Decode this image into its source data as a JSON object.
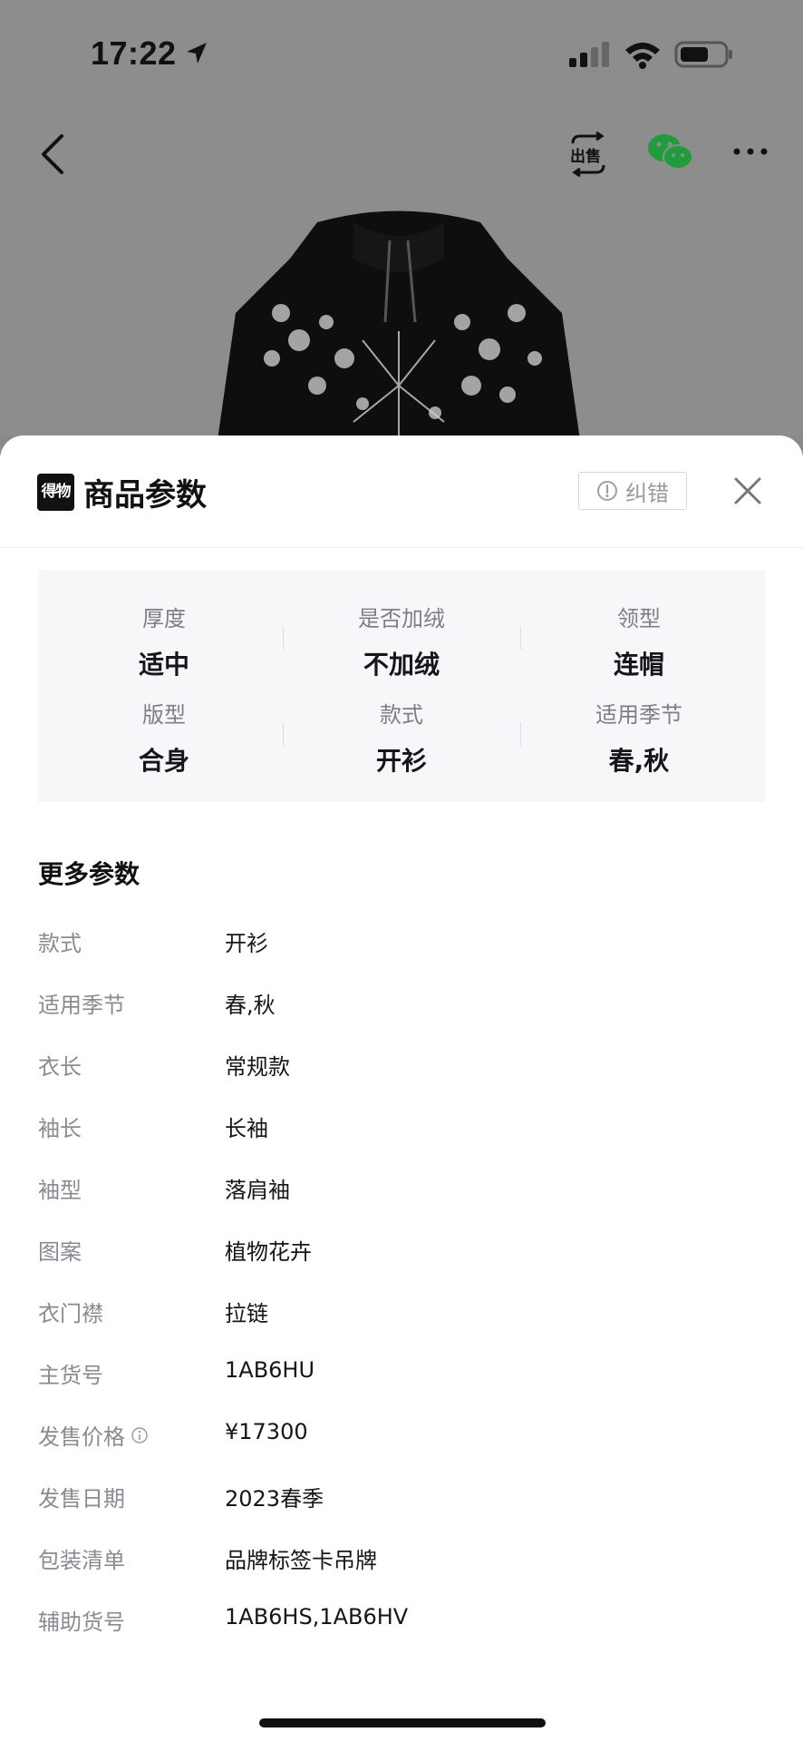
{
  "status_bar": {
    "time": "17:22"
  },
  "sheet": {
    "logo_text": "得物",
    "title": "商品参数",
    "report_label": "纠错"
  },
  "params": [
    {
      "label": "厚度",
      "value": "适中"
    },
    {
      "label": "是否加绒",
      "value": "不加绒"
    },
    {
      "label": "领型",
      "value": "连帽"
    },
    {
      "label": "版型",
      "value": "合身"
    },
    {
      "label": "款式",
      "value": "开衫"
    },
    {
      "label": "适用季节",
      "value": "春,秋"
    }
  ],
  "more": {
    "title": "更多参数",
    "rows": [
      {
        "key": "款式",
        "value": "开衫"
      },
      {
        "key": "适用季节",
        "value": "春,秋"
      },
      {
        "key": "衣长",
        "value": "常规款"
      },
      {
        "key": "袖长",
        "value": "长袖"
      },
      {
        "key": "袖型",
        "value": "落肩袖"
      },
      {
        "key": "图案",
        "value": "植物花卉"
      },
      {
        "key": "衣门襟",
        "value": "拉链"
      },
      {
        "key": "主货号",
        "value": "1AB6HU"
      },
      {
        "key": "发售价格",
        "value": "¥17300"
      },
      {
        "key": "发售日期",
        "value": "2023春季"
      },
      {
        "key": "包装清单",
        "value": "品牌标签卡吊牌"
      },
      {
        "key": "辅助货号",
        "value": "1AB6HS,1AB6HV"
      }
    ]
  }
}
